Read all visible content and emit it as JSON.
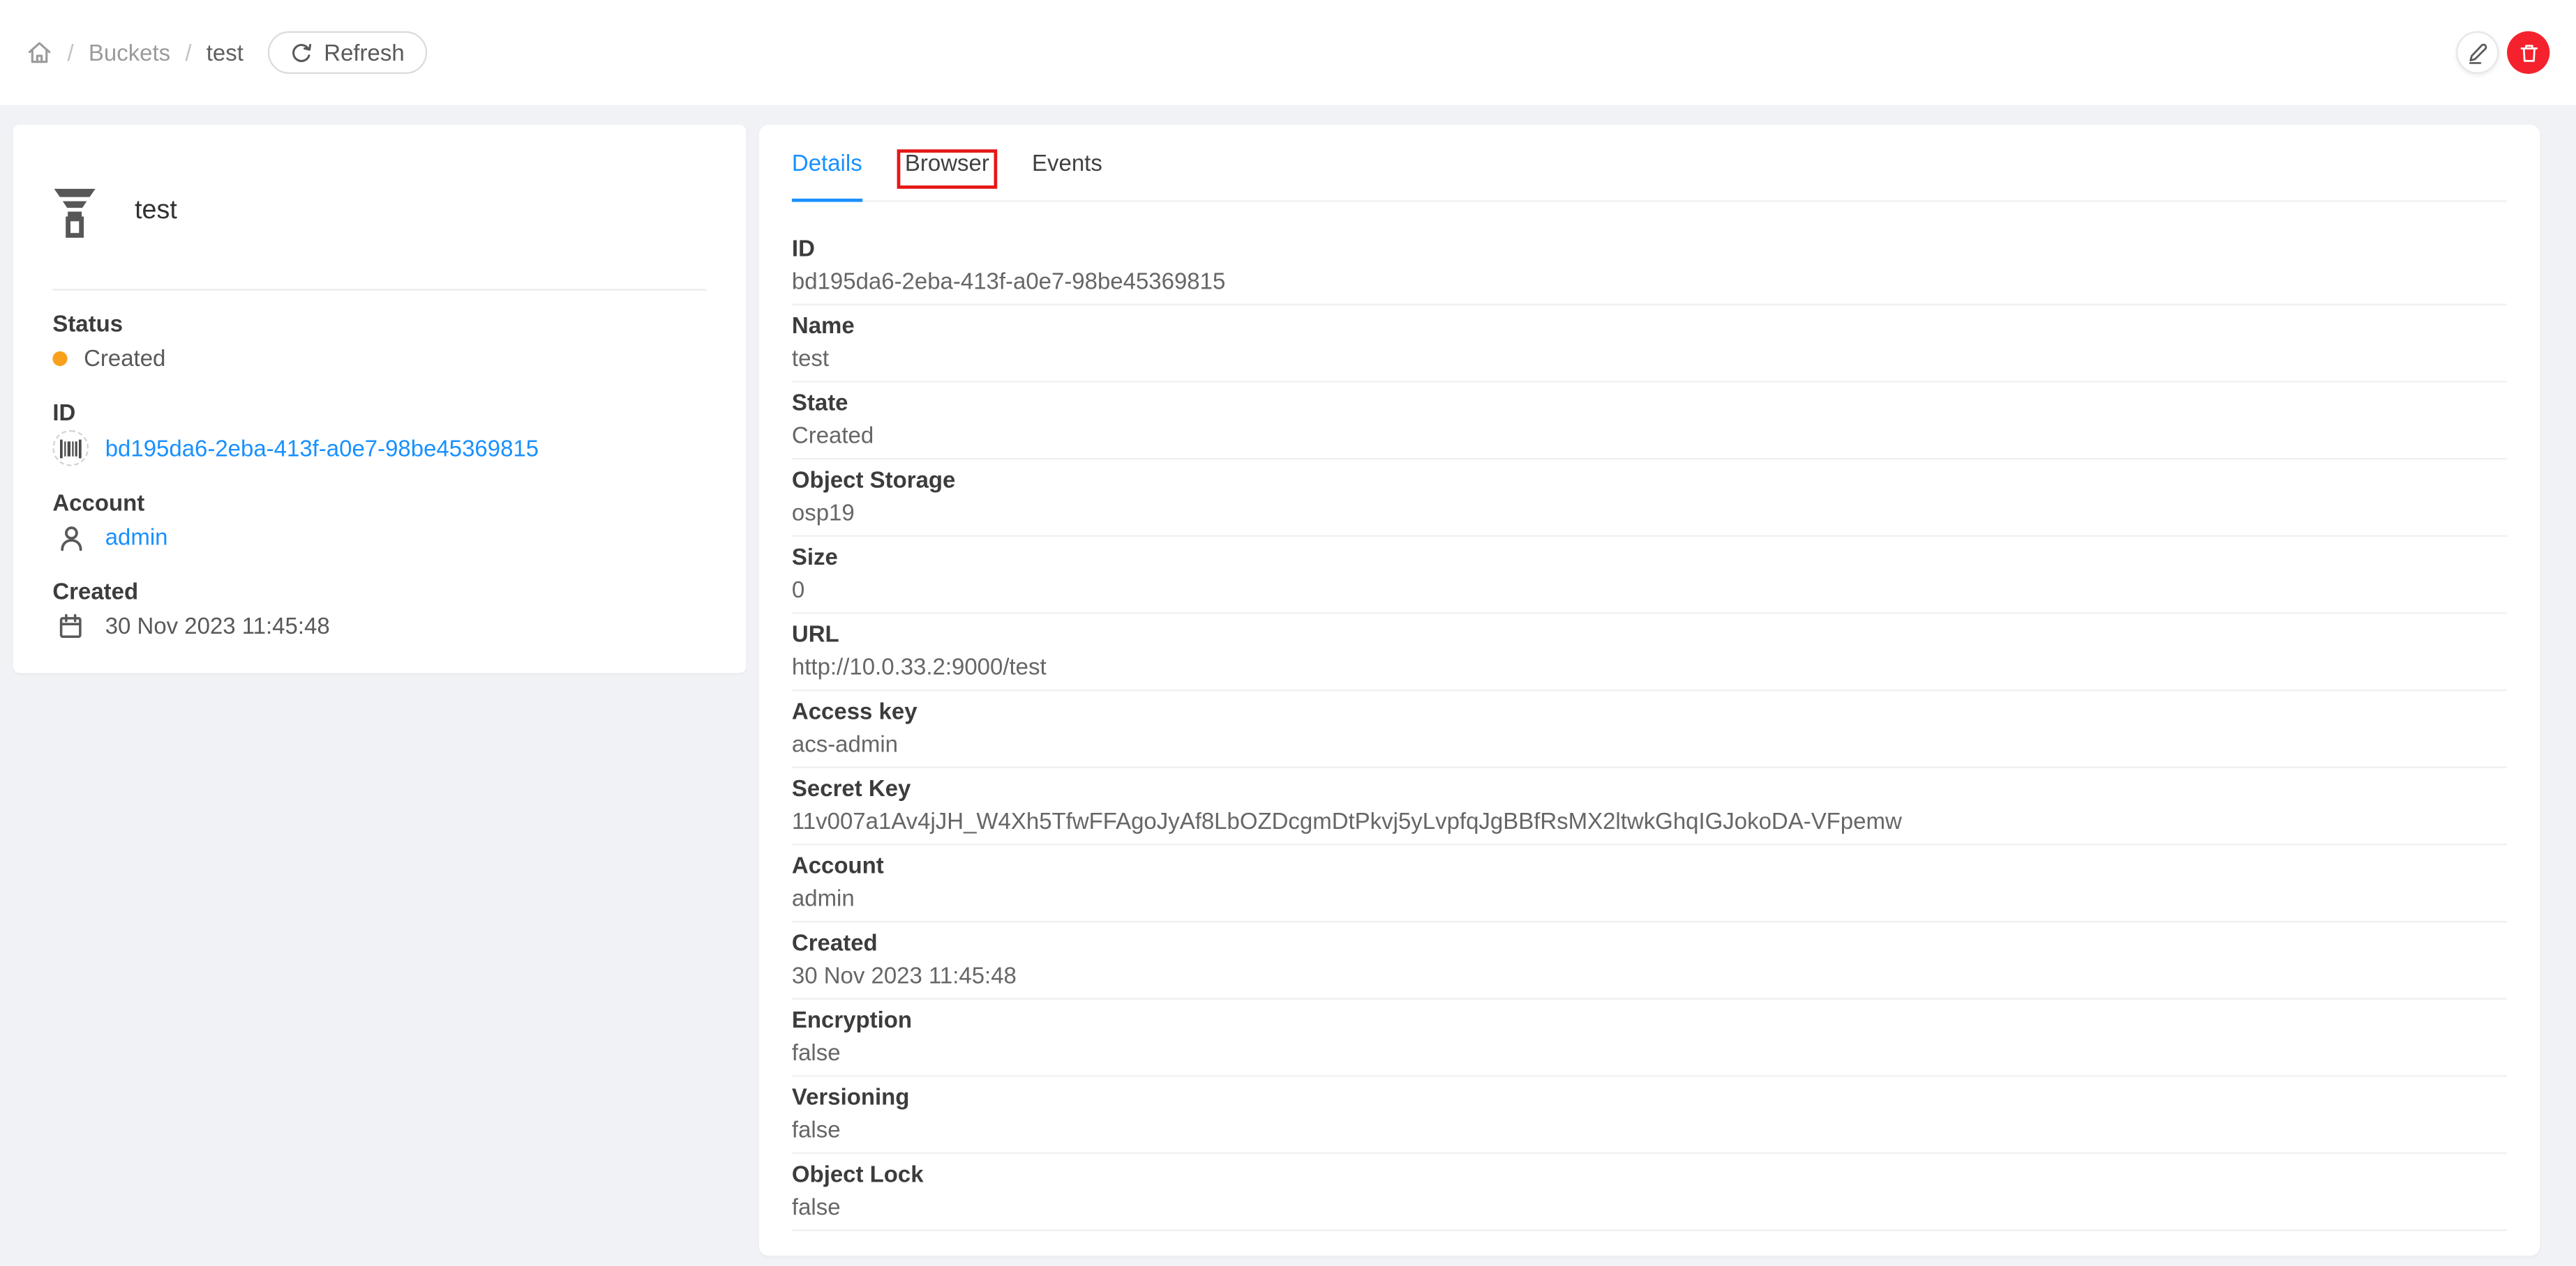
{
  "topbar": {
    "breadcrumb": {
      "home_icon": "house-outline",
      "items": [
        {
          "label": "Buckets",
          "link": true
        },
        {
          "label": "test",
          "link": false
        }
      ],
      "separator": "/"
    },
    "refresh_label": "Refresh",
    "actions": [
      {
        "name": "edit",
        "icon": "pencil-icon"
      },
      {
        "name": "delete",
        "icon": "trash-icon"
      }
    ]
  },
  "sidebar": {
    "resource_icon": "funnel-bucket-icon",
    "title": "test",
    "status_label": "Status",
    "status_value": "Created",
    "id_label": "ID",
    "id_value": "bd195da6-2eba-413f-a0e7-98be45369815",
    "id_icon": "barcode-icon",
    "account_label": "Account",
    "account_value": "admin",
    "account_icon": "user-icon",
    "created_label": "Created",
    "created_value": "30 Nov 2023 11:45:48",
    "created_icon": "calendar-icon"
  },
  "tabs": [
    {
      "label": "Details",
      "active": true
    },
    {
      "label": "Browser",
      "active": false,
      "annotated": true
    },
    {
      "label": "Events",
      "active": false
    }
  ],
  "details": {
    "rows": [
      {
        "label": "ID",
        "value": "bd195da6-2eba-413f-a0e7-98be45369815"
      },
      {
        "label": "Name",
        "value": "test"
      },
      {
        "label": "State",
        "value": "Created"
      },
      {
        "label": "Object Storage",
        "value": "osp19"
      },
      {
        "label": "Size",
        "value": "0"
      },
      {
        "label": "URL",
        "value": "http://10.0.33.2:9000/test"
      },
      {
        "label": "Access key",
        "value": "acs-admin"
      },
      {
        "label": "Secret Key",
        "value": "11v007a1Av4jJH_W4Xh5TfwFFAgoJyAf8LbOZDcgmDtPkvj5yLvpfqJgBBfRsMX2ltwkGhqIGJokoDA-VFpemw"
      },
      {
        "label": "Account",
        "value": "admin"
      },
      {
        "label": "Created",
        "value": "30 Nov 2023 11:45:48"
      },
      {
        "label": "Encryption",
        "value": "false"
      },
      {
        "label": "Versioning",
        "value": "false"
      },
      {
        "label": "Object Lock",
        "value": "false"
      }
    ]
  },
  "icons": {
    "home": "⌂",
    "refresh": "⟳",
    "edit": "✎",
    "delete": "🗑",
    "funnel": "funnel",
    "barcode": "|||",
    "user": "👤",
    "calendar": "📅",
    "status-dot": "●"
  },
  "colors": {
    "accent": "#1890ff",
    "link": "#1890ff",
    "status_created_dot": "#f9a11b",
    "delete_button": "#f5222d",
    "annotation_red": "#e51717",
    "page_bg": "#f0f2f5",
    "divider": "#f0f0f0"
  }
}
